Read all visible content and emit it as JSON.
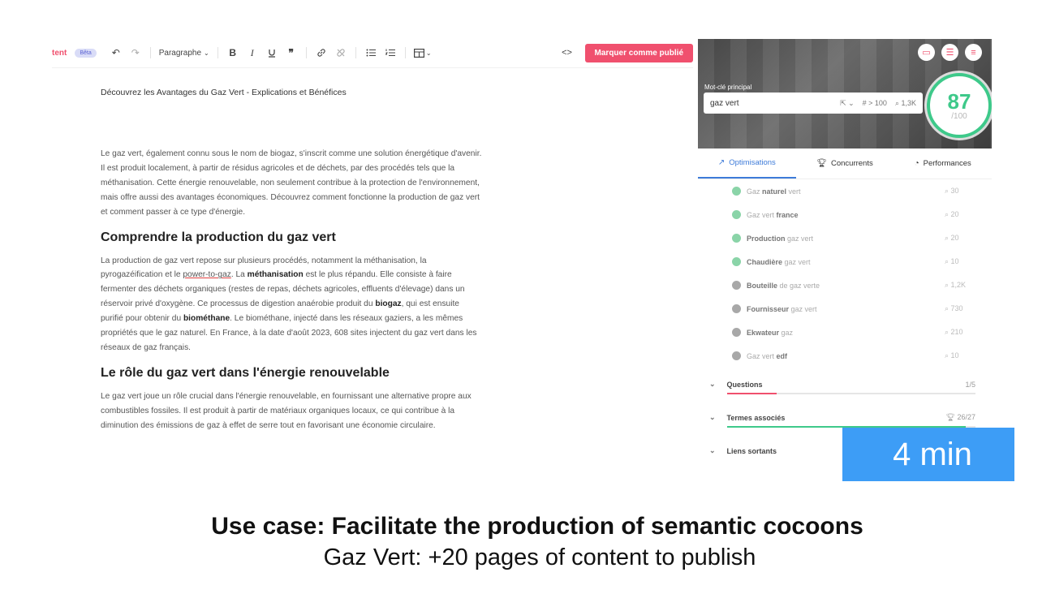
{
  "toolbar": {
    "brand_fragment": "tent",
    "beta": "Bêta",
    "paragraph_select": "Paragraphe",
    "bold": "B",
    "italic": "I",
    "publish_button": "Marquer comme publié"
  },
  "document": {
    "title": "Découvrez les Avantages du Gaz Vert - Explications et Bénéfices",
    "intro": "Le gaz vert, également connu sous le nom de biogaz, s'inscrit comme une solution énergétique d'avenir. Il est produit localement, à partir de résidus agricoles et de déchets, par des procédés tels que la méthanisation. Cette énergie renouvelable, non seulement contribue à la protection de l'environnement, mais offre aussi des avantages économiques. Découvrez comment fonctionne la production de gaz vert et comment passer à ce type d'énergie.",
    "h2_production": "Comprendre la production du gaz vert",
    "production": {
      "p1": "La production de gaz vert repose sur plusieurs procédés, notamment la méthanisation, la pyrogazéification et le ",
      "power_to_gaz": "power-to-gaz",
      "p2": ". La ",
      "methanisation": "méthanisation",
      "p3": " est le plus répandu. Elle consiste à faire fermenter des déchets organiques (restes de repas, déchets agricoles, effluents d'élevage) dans un réservoir privé d'oxygène. Ce processus de digestion anaérobie produit du ",
      "biogaz": "biogaz",
      "p4": ", qui est ensuite purifié pour obtenir du ",
      "biomethane": "biométhane",
      "p5": ". Le biométhane, injecté dans les réseaux gaziers, a les mêmes propriétés que le gaz naturel. En France, à la date d'août 2023, 608 sites injectent du gaz vert dans les réseaux de gaz français."
    },
    "h2_role": "Le rôle du gaz vert dans l'énergie renouvelable",
    "role": "Le gaz vert joue un rôle crucial dans l'énergie renouvelable, en fournissant une alternative propre aux combustibles fossiles. Il est produit à partir de matériaux organiques locaux, ce qui contribue à la diminution des émissions de gaz à effet de serre tout en favorisant une économie circulaire."
  },
  "panel": {
    "keyword_label": "Mot-clé principal",
    "keyword_value": "gaz vert",
    "keyword_volume": "# > 100",
    "keyword_search": "1,3K",
    "score": "87",
    "score_max": "/100",
    "tabs": [
      "Optimisations",
      "Concurrents",
      "Performances"
    ],
    "keywords": [
      {
        "pre": "Gaz ",
        "bold": "naturel",
        "post": " vert",
        "volume": "30",
        "color": "#8ad4a8"
      },
      {
        "pre": "Gaz vert ",
        "bold": "france",
        "post": "",
        "volume": "20",
        "color": "#8ad4a8"
      },
      {
        "pre": "",
        "bold": "Production",
        "post": " gaz vert",
        "volume": "20",
        "color": "#8ad4a8"
      },
      {
        "pre": "",
        "bold": "Chaudière",
        "post": " gaz vert",
        "volume": "10",
        "color": "#8ad4a8"
      },
      {
        "pre": "",
        "bold": "Bouteille",
        "post": " de gaz verte",
        "volume": "1,2K",
        "color": "#a8a8a8"
      },
      {
        "pre": "",
        "bold": "Fournisseur",
        "post": " gaz vert",
        "volume": "730",
        "color": "#a8a8a8"
      },
      {
        "pre": "",
        "bold": "Ekwateur",
        "post": " gaz",
        "volume": "210",
        "color": "#a8a8a8"
      },
      {
        "pre": "Gaz vert ",
        "bold": "edf",
        "post": "",
        "volume": "10",
        "color": "#a8a8a8"
      }
    ],
    "questions_label": "Questions",
    "questions_count": "1/5",
    "questions_progress": 0.2,
    "termes_label": "Termes associés",
    "termes_count": "26/27",
    "termes_progress": 0.96,
    "liens_label": "Liens sortants"
  },
  "badge": {
    "time": "4 min"
  },
  "caption": {
    "title": "Use case: Facilitate the production of semantic cocoons",
    "subtitle": "Gaz Vert: +20 pages of content to publish"
  },
  "colors": {
    "accent": "#f0506e",
    "score": "#3ec98a",
    "tab_active": "#3d7bd9",
    "badge": "#3d9df6"
  }
}
